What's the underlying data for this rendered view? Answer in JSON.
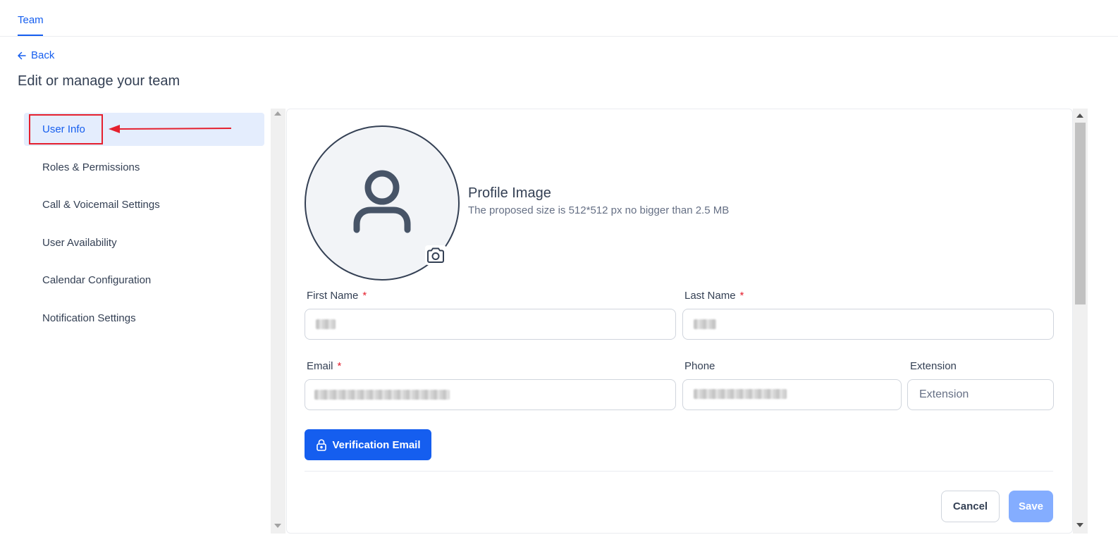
{
  "header": {
    "active_tab": "Team"
  },
  "back": {
    "label": "Back"
  },
  "page": {
    "title": "Edit or manage your team"
  },
  "sidebar": {
    "items": [
      {
        "label": "User Info",
        "active": true
      },
      {
        "label": "Roles & Permissions",
        "active": false
      },
      {
        "label": "Call & Voicemail Settings",
        "active": false
      },
      {
        "label": "User Availability",
        "active": false
      },
      {
        "label": "Calendar Configuration",
        "active": false
      },
      {
        "label": "Notification Settings",
        "active": false
      }
    ]
  },
  "profile": {
    "title": "Profile Image",
    "subtitle": "The proposed size is 512*512 px no bigger than 2.5 MB"
  },
  "form": {
    "first_name": {
      "label": "First Name",
      "required_mark": "*"
    },
    "last_name": {
      "label": "Last Name",
      "required_mark": "*"
    },
    "email": {
      "label": "Email",
      "required_mark": "*"
    },
    "phone": {
      "label": "Phone"
    },
    "extension": {
      "label": "Extension",
      "placeholder": "Extension"
    }
  },
  "buttons": {
    "verification": "Verification Email",
    "cancel": "Cancel",
    "save": "Save"
  },
  "icons": {
    "back": "arrow-left-icon",
    "avatar": "user-icon",
    "camera": "camera-icon",
    "verification": "lock-icon"
  },
  "colors": {
    "accent": "#155eef",
    "active_bg": "#e4edfd",
    "annotation": "#e5202e",
    "save_disabled": "#84adff"
  }
}
